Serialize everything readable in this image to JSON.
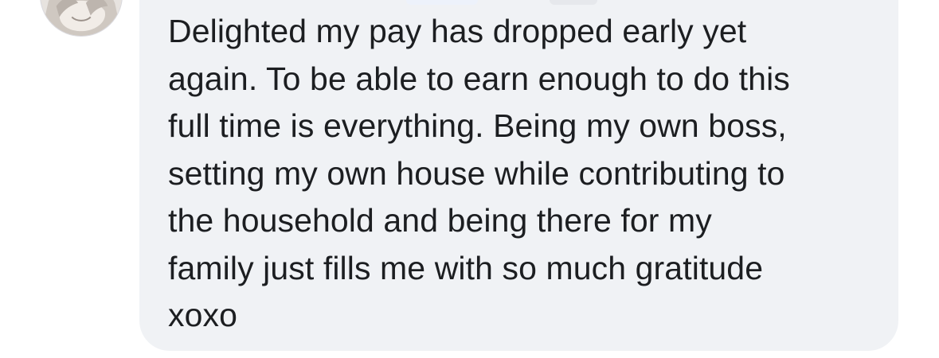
{
  "comment": {
    "text": "Delighted my pay has dropped early yet\nagain. To be able to earn enough to do this\nfull time is everything. Being my own boss,\nsetting my own house while contributing to\nthe household and being there for my\nfamily just fills me with so much gratitude\nxoxo"
  },
  "colors": {
    "bubble_background": "#f0f2f5",
    "text": "#1c1e21"
  },
  "icons": {
    "avatar": "profile-photo"
  }
}
